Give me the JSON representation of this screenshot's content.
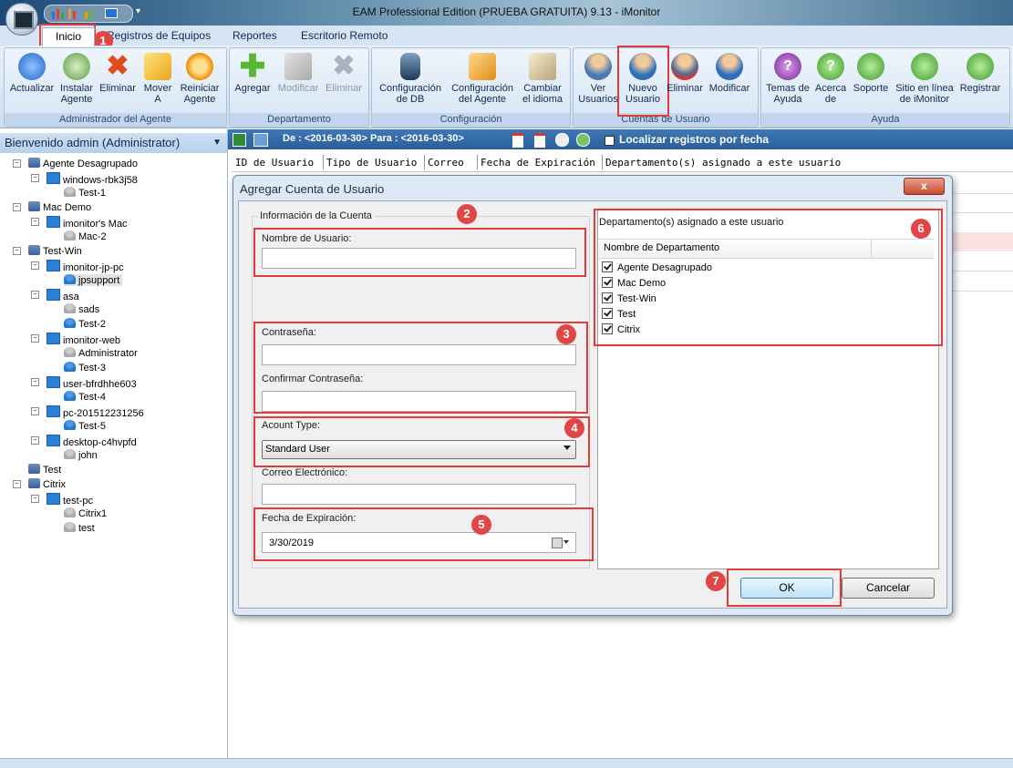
{
  "window": {
    "title": "EAM Professional Edition (PRUEBA GRATUITA) 9.13 - iMonitor"
  },
  "tabs": [
    "Inicio",
    "Registros de Equipos",
    "Reportes",
    "Escritorio Remoto"
  ],
  "ribbon": {
    "groups": [
      "Administrador del Agente",
      "Departamento",
      "Configuración",
      "Cuentas de Usuario",
      "Ayuda"
    ],
    "buttons": {
      "actualizar": [
        "Actualizar",
        ""
      ],
      "instalar": [
        "Instalar",
        "Agente"
      ],
      "eliminar_agente": [
        "Eliminar",
        ""
      ],
      "mover": [
        "Mover",
        "A"
      ],
      "reiniciar": [
        "Reiniciar",
        "Agente"
      ],
      "agregar": [
        "Agregar",
        ""
      ],
      "modificar_dep": [
        "Modificar",
        ""
      ],
      "eliminar_dep": [
        "Eliminar",
        ""
      ],
      "config_db": [
        "Configuración",
        "de DB"
      ],
      "config_agente": [
        "Configuración",
        "del Agente"
      ],
      "cambiar_idioma": [
        "Cambiar",
        "el idioma"
      ],
      "ver_usuarios": [
        "Ver",
        "Usuarios"
      ],
      "nuevo_usuario": [
        "Nuevo",
        "Usuario"
      ],
      "eliminar_usuario": [
        "Eliminar",
        ""
      ],
      "modificar_usuario": [
        "Modificar",
        ""
      ],
      "temas": [
        "Temas de",
        "Ayuda"
      ],
      "acerca": [
        "Acerca",
        "de"
      ],
      "soporte": [
        "Soporte",
        ""
      ],
      "sitio": [
        "Sitio en línea",
        "de iMonitor"
      ],
      "registrar": [
        "Registrar",
        ""
      ]
    }
  },
  "left_panel": {
    "header": "Bienvenido admin (Administrator)",
    "tree": [
      "Agente Desagrupado",
      "windows-rbk3j58",
      "Test-1",
      "Mac Demo",
      "imonitor's Mac",
      "Mac-2",
      "Test-Win",
      "imonitor-jp-pc",
      "jpsupport",
      "asa",
      "sads",
      "Test-2",
      "imonitor-web",
      "Administrator",
      "Test-3",
      "user-bfrdhhe603",
      "Test-4",
      "pc-201512231256",
      "Test-5",
      "desktop-c4hvpfd",
      "john",
      "Test",
      "Citrix",
      "test-pc",
      "Citrix1",
      "test"
    ]
  },
  "toolbar": {
    "date_range": "De : <2016-03-30> Para : <2016-03-30>",
    "localizar": "Localizar registros por fecha"
  },
  "grid": {
    "columns": [
      "ID de Usuario",
      "Tipo de Usuario",
      "Correo",
      "Fecha de Expiración",
      "Departamento(s) asignado a este usuario"
    ]
  },
  "dialog": {
    "title": "Agregar Cuenta de Usuario",
    "close": "x",
    "account_info": "Información de la Cuenta",
    "username_label": "Nombre de Usuario:",
    "username_value": "",
    "password_label": "Contraseña:",
    "confirm_label": "Confirmar Contraseña:",
    "account_type_label": "Acount Type:",
    "account_type_value": "Standard User",
    "email_label": "Correo Electrónico:",
    "expiration_label": "Fecha de Expiración:",
    "expiration_value": "3/30/2019",
    "dept_title": "Departamento(s) asignado a este usuario",
    "dept_column": "Nombre de Departamento",
    "departments": [
      "Agente Desagrupado",
      "Mac Demo",
      "Test-Win",
      "Test",
      "Citrix"
    ],
    "ok": "OK",
    "cancel": "Cancelar"
  },
  "badges": [
    "1",
    "2",
    "3",
    "4",
    "5",
    "6",
    "7"
  ],
  "colors": {
    "highlight": "#e03c3c",
    "header_blue": "#2b5f98"
  }
}
